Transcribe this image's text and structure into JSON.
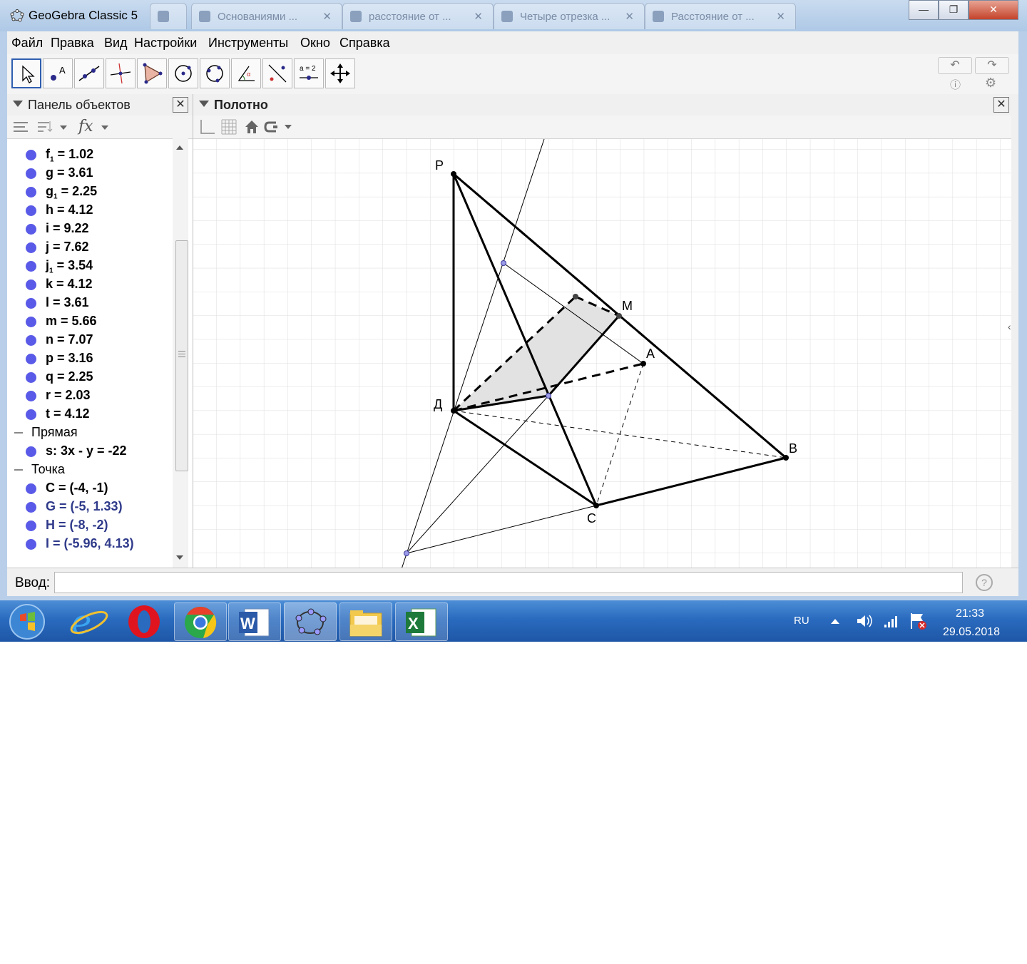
{
  "window": {
    "title": "GeoGebra Classic 5",
    "tabs": [
      "Основаниями ...",
      "расстояние от ...",
      "Четыре отрезка ...",
      "Расстояние от ..."
    ]
  },
  "menu": [
    "Файл",
    "Правка",
    "Вид",
    "Настройки",
    "Инструменты",
    "Окно",
    "Справка"
  ],
  "toolbar": {
    "tools": [
      "move-tool",
      "point-tool",
      "line-tool",
      "perpendicular-tool",
      "polygon-tool",
      "circle-tool",
      "conic-tool",
      "angle-tool",
      "reflect-tool",
      "slider-tool",
      "move-view-tool"
    ],
    "slider_label": "a = 2"
  },
  "algebra": {
    "title": "Панель объектов",
    "rows": [
      {
        "type": "item",
        "name": "f",
        "sub": "1",
        "value": " = 1.02"
      },
      {
        "type": "item",
        "name": "g",
        "sub": "",
        "value": " = 3.61"
      },
      {
        "type": "item",
        "name": "g",
        "sub": "1",
        "value": " = 2.25"
      },
      {
        "type": "item",
        "name": "h",
        "sub": "",
        "value": " = 4.12"
      },
      {
        "type": "item",
        "name": "i",
        "sub": "",
        "value": " = 9.22"
      },
      {
        "type": "item",
        "name": "j",
        "sub": "",
        "value": " = 7.62"
      },
      {
        "type": "item",
        "name": "j",
        "sub": "1",
        "value": " = 3.54"
      },
      {
        "type": "item",
        "name": "k",
        "sub": "",
        "value": " = 4.12"
      },
      {
        "type": "item",
        "name": "l",
        "sub": "",
        "value": " = 3.61"
      },
      {
        "type": "item",
        "name": "m",
        "sub": "",
        "value": " = 5.66"
      },
      {
        "type": "item",
        "name": "n",
        "sub": "",
        "value": " = 7.07"
      },
      {
        "type": "item",
        "name": "p",
        "sub": "",
        "value": " = 3.16"
      },
      {
        "type": "item",
        "name": "q",
        "sub": "",
        "value": " = 2.25"
      },
      {
        "type": "item",
        "name": "r",
        "sub": "",
        "value": " = 2.03"
      },
      {
        "type": "item",
        "name": "t",
        "sub": "",
        "value": " = 4.12"
      },
      {
        "type": "group",
        "label": "Прямая"
      },
      {
        "type": "item",
        "name": "s",
        "sub": "",
        "value": ": 3x - y = -22"
      },
      {
        "type": "group",
        "label": "Точка"
      },
      {
        "type": "item",
        "name": "C",
        "sub": "",
        "value": " = (-4, -1)"
      },
      {
        "type": "item",
        "name": "G",
        "sub": "",
        "value": " = (-5, 1.33)",
        "aux": true
      },
      {
        "type": "item",
        "name": "H",
        "sub": "",
        "value": " = (-8, -2)",
        "aux": true
      },
      {
        "type": "item",
        "name": "I",
        "sub": "",
        "value": " = (-5.96, 4.13)",
        "aux": true
      }
    ]
  },
  "graphics": {
    "title": "Полотно",
    "labels": {
      "P": "P",
      "M": "M",
      "A": "A",
      "D": "Д",
      "B": "B",
      "C": "C"
    }
  },
  "input": {
    "label": "Ввод:"
  },
  "taskbar": {
    "lang": "RU",
    "time": "21:33",
    "date": "29.05.2018",
    "apps": [
      "start",
      "internet-explorer",
      "opera",
      "chrome",
      "word",
      "geogebra",
      "explorer",
      "excel"
    ]
  },
  "colors": {
    "accent": "#2f5fb0",
    "point": "#5a5ae8",
    "taskbar": "#2a6bbf"
  }
}
